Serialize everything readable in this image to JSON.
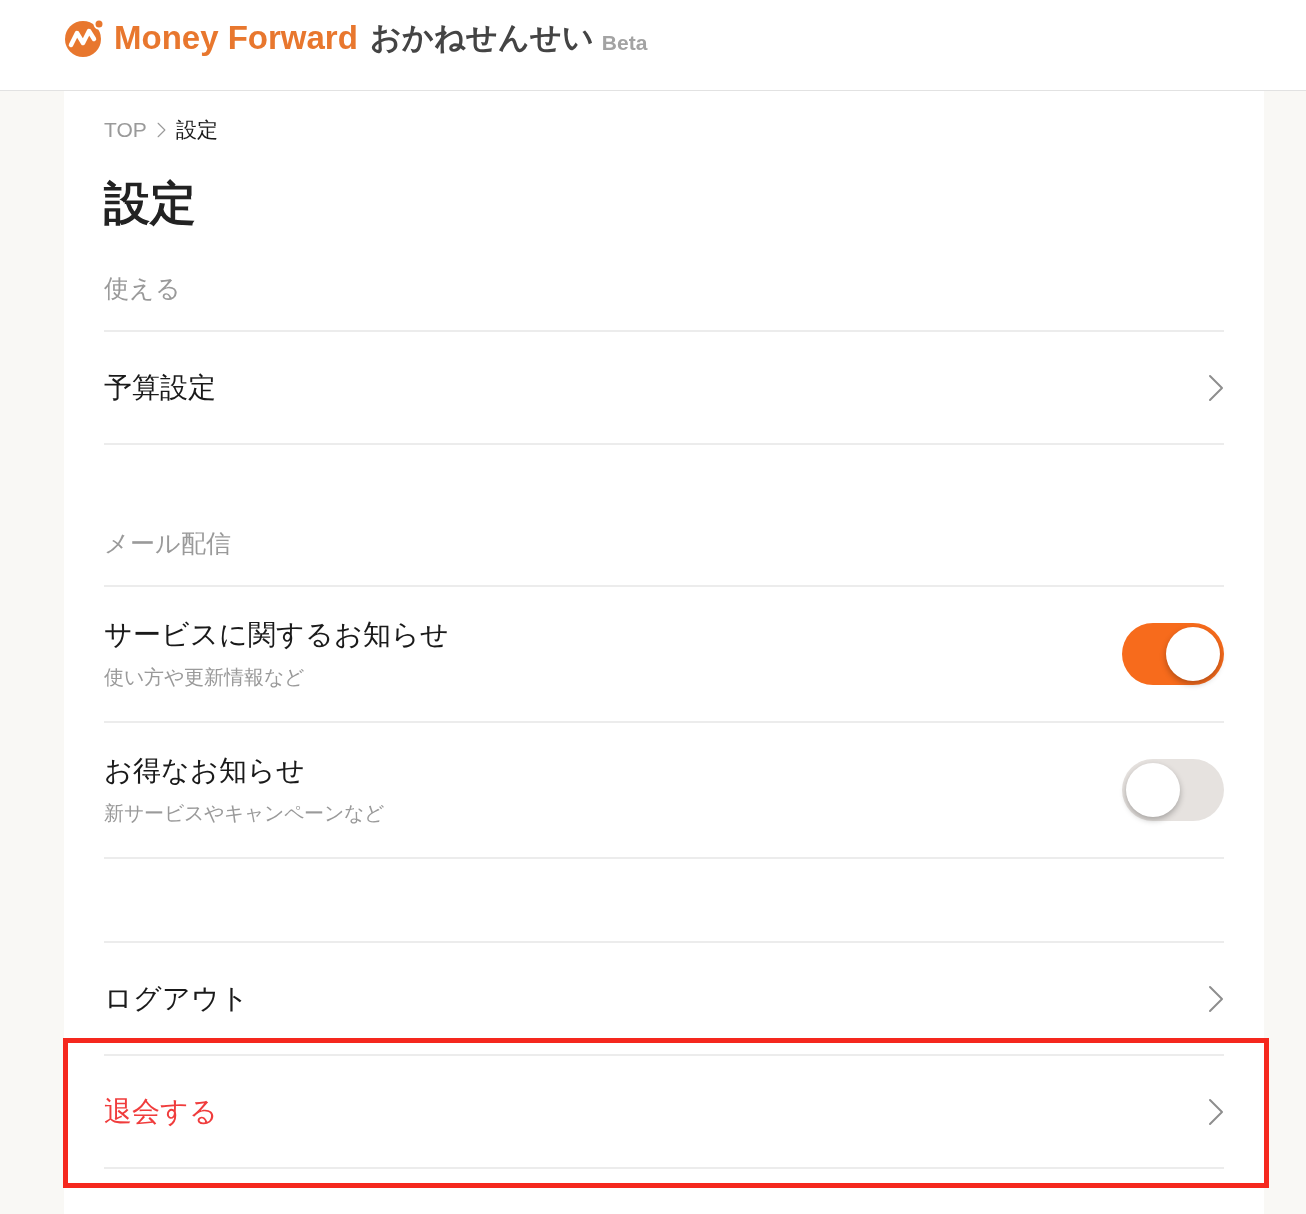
{
  "header": {
    "brand": "Money Forward",
    "product": "おかねせんせい",
    "badge": "Beta"
  },
  "breadcrumb": [
    {
      "label": "TOP",
      "current": false
    },
    {
      "label": "設定",
      "current": true
    }
  ],
  "title": "設定",
  "sections": [
    {
      "label": "使える",
      "items": [
        {
          "kind": "link",
          "label": "予算設定",
          "danger": false,
          "highlighted": false
        }
      ]
    },
    {
      "label": "メール配信",
      "items": [
        {
          "kind": "toggle",
          "label": "サービスに関するお知らせ",
          "description": "使い方や更新情報など",
          "on": true
        },
        {
          "kind": "toggle",
          "label": "お得なお知らせ",
          "description": "新サービスやキャンペーンなど",
          "on": false
        }
      ]
    },
    {
      "items": [
        {
          "kind": "link",
          "label": "ログアウト",
          "danger": false,
          "highlighted": false
        },
        {
          "kind": "link",
          "label": "退会する",
          "danger": true,
          "highlighted": true
        }
      ]
    }
  ]
}
